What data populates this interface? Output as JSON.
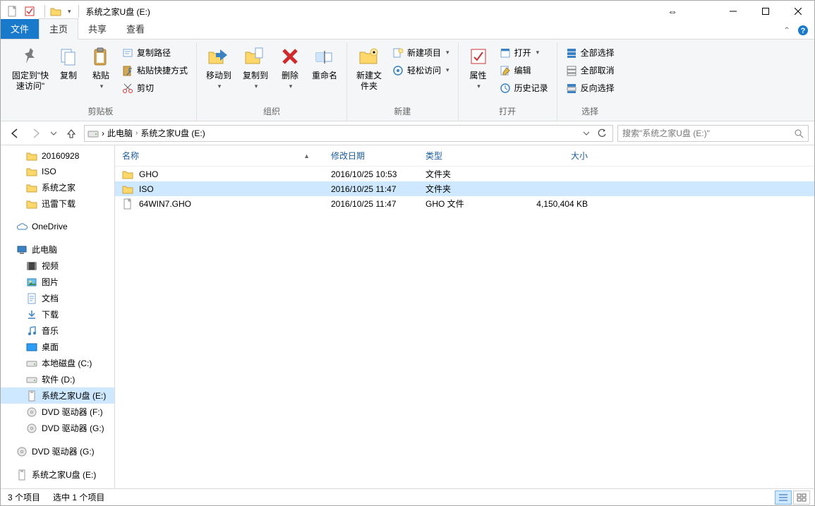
{
  "title": "系统之家U盘 (E:)",
  "tabs": {
    "file": "文件",
    "home": "主页",
    "share": "共享",
    "view": "查看"
  },
  "ribbon": {
    "pin": "固定到\"快速访问\"",
    "copy": "复制",
    "paste": "粘贴",
    "copy_path": "复制路径",
    "paste_shortcut": "粘贴快捷方式",
    "cut": "剪切",
    "clipboard": "剪贴板",
    "move_to": "移动到",
    "copy_to": "复制到",
    "delete": "删除",
    "rename": "重命名",
    "organize": "组织",
    "new_folder": "新建文件夹",
    "new_item": "新建项目",
    "easy_access": "轻松访问",
    "new": "新建",
    "properties": "属性",
    "open_btn": "打开",
    "edit": "编辑",
    "history": "历史记录",
    "open": "打开",
    "select_all": "全部选择",
    "select_none": "全部取消",
    "invert": "反向选择",
    "select": "选择"
  },
  "breadcrumbs": [
    "此电脑",
    "系统之家U盘 (E:)"
  ],
  "search_placeholder": "搜索\"系统之家U盘 (E:)\"",
  "sidebar": [
    {
      "label": "20160928",
      "icon": "folder",
      "indent": true
    },
    {
      "label": "ISO",
      "icon": "folder",
      "indent": true
    },
    {
      "label": "系统之家",
      "icon": "folder",
      "indent": true
    },
    {
      "label": "迅雷下载",
      "icon": "folder",
      "indent": true
    },
    {
      "spacer": true
    },
    {
      "label": "OneDrive",
      "icon": "cloud",
      "indent": false
    },
    {
      "spacer": true
    },
    {
      "label": "此电脑",
      "icon": "pc",
      "indent": false
    },
    {
      "label": "视频",
      "icon": "video",
      "indent": true
    },
    {
      "label": "图片",
      "icon": "pictures",
      "indent": true
    },
    {
      "label": "文档",
      "icon": "docs",
      "indent": true
    },
    {
      "label": "下载",
      "icon": "download",
      "indent": true
    },
    {
      "label": "音乐",
      "icon": "music",
      "indent": true
    },
    {
      "label": "桌面",
      "icon": "desktop",
      "indent": true
    },
    {
      "label": "本地磁盘 (C:)",
      "icon": "drive",
      "indent": true
    },
    {
      "label": "软件 (D:)",
      "icon": "drive",
      "indent": true
    },
    {
      "label": "系统之家U盘 (E:)",
      "icon": "usb",
      "indent": true,
      "selected": true
    },
    {
      "label": "DVD 驱动器 (F:)",
      "icon": "dvd",
      "indent": true
    },
    {
      "label": "DVD 驱动器 (G:)",
      "icon": "dvd",
      "indent": true
    },
    {
      "spacer": true
    },
    {
      "label": "DVD 驱动器 (G:)",
      "icon": "dvd",
      "indent": false
    },
    {
      "spacer": true
    },
    {
      "label": "系统之家U盘 (E:)",
      "icon": "usb",
      "indent": false
    }
  ],
  "columns": {
    "name": "名称",
    "date": "修改日期",
    "type": "类型",
    "size": "大小"
  },
  "files": [
    {
      "name": "GHO",
      "date": "2016/10/25 10:53",
      "type": "文件夹",
      "size": "",
      "icon": "folder",
      "selected": false
    },
    {
      "name": "ISO",
      "date": "2016/10/25 11:47",
      "type": "文件夹",
      "size": "",
      "icon": "folder",
      "selected": true
    },
    {
      "name": "64WIN7.GHO",
      "date": "2016/10/25 11:47",
      "type": "GHO 文件",
      "size": "4,150,404 KB",
      "icon": "file",
      "selected": false
    }
  ],
  "status": {
    "items": "3 个项目",
    "selected": "选中 1 个项目"
  }
}
